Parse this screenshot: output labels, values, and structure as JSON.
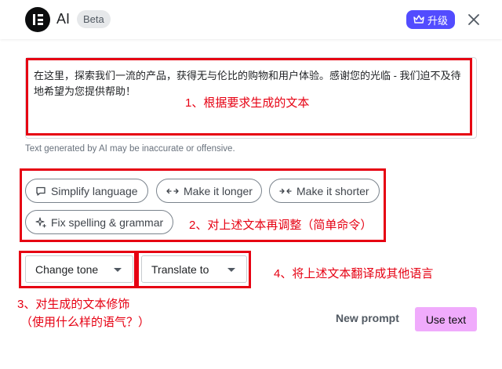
{
  "header": {
    "title": "AI",
    "badge": "Beta",
    "upgrade_label": "升级",
    "upgrade_icon": "crown-icon",
    "close_icon": "close-icon",
    "logo_icon": "elementor-logo-icon"
  },
  "result": {
    "text": "在这里，探索我们一流的产品，获得无与伦比的购物和用户体验。感谢您的光临 - 我们迫不及待地希望为您提供帮助！",
    "disclaimer": "Text generated by AI may be inaccurate or offensive."
  },
  "actions": [
    {
      "label": "Simplify language",
      "icon": "speech-bubble-icon"
    },
    {
      "label": "Make it longer",
      "icon": "expand-arrows-icon"
    },
    {
      "label": "Make it shorter",
      "icon": "collapse-arrows-icon"
    },
    {
      "label": "Fix spelling & grammar",
      "icon": "sparkle-icon"
    }
  ],
  "selects": {
    "tone": "Change tone",
    "translate": "Translate to"
  },
  "footer": {
    "new_prompt": "New prompt",
    "use_text": "Use text"
  },
  "annotations": {
    "note1": "1、根据要求生成的文本",
    "note2": "2、对上述文本再调整（简单命令）",
    "note3_line1": "3、对生成的文本修饰",
    "note3_line2": "（使用什么样的语气？）",
    "note4": "4、将上述文本翻译成其他语言"
  },
  "colors": {
    "accent": "#524cff",
    "use_button": "#f0abfc",
    "annotation_red": "#e60012"
  }
}
